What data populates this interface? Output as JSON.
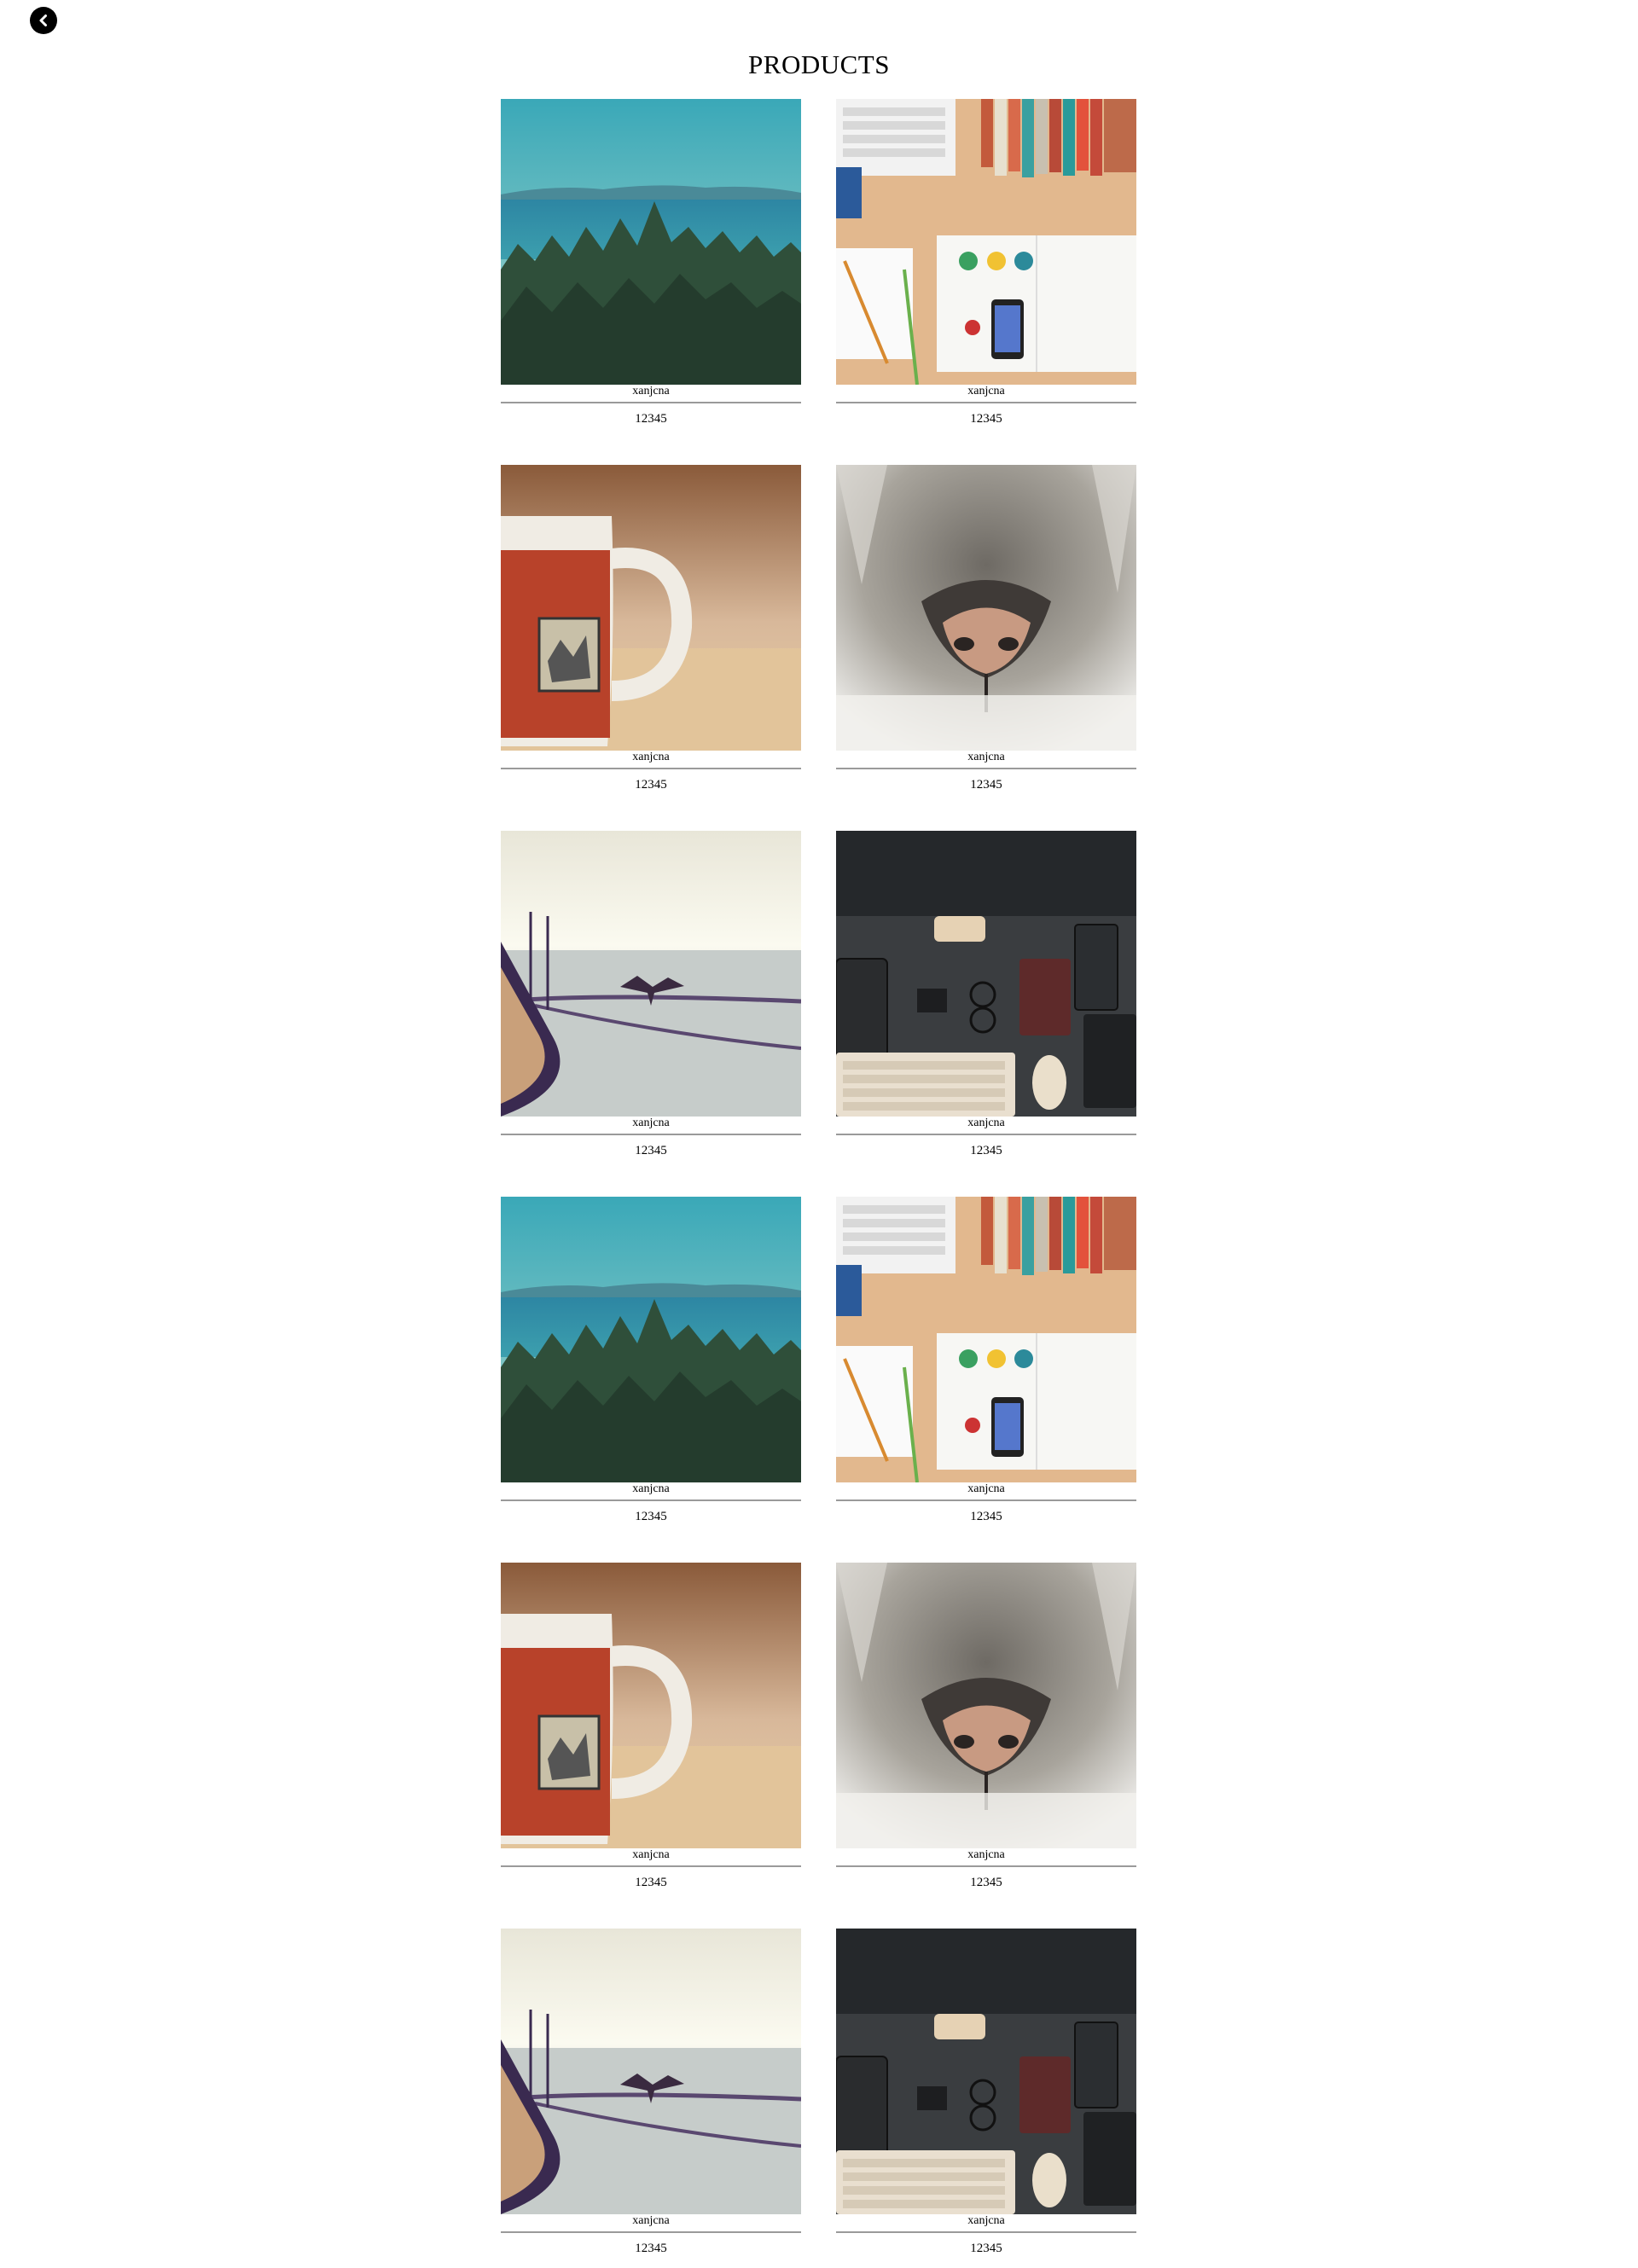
{
  "header": {
    "back_icon": "chevron-left-circle-icon",
    "title": "PRODUCTS"
  },
  "products": [
    {
      "name": "xanjcna",
      "price": "12345",
      "image": "forest-lake-photo"
    },
    {
      "name": "xanjcna",
      "price": "12345",
      "image": "desk-flatlay-photo"
    },
    {
      "name": "xanjcna",
      "price": "12345",
      "image": "coffee-mug-photo"
    },
    {
      "name": "xanjcna",
      "price": "12345",
      "image": "cat-nose-photo"
    },
    {
      "name": "xanjcna",
      "price": "12345",
      "image": "bird-boat-photo"
    },
    {
      "name": "xanjcna",
      "price": "12345",
      "image": "dark-desk-photo"
    },
    {
      "name": "xanjcna",
      "price": "12345",
      "image": "forest-lake-photo"
    },
    {
      "name": "xanjcna",
      "price": "12345",
      "image": "desk-flatlay-photo"
    },
    {
      "name": "xanjcna",
      "price": "12345",
      "image": "coffee-mug-photo"
    },
    {
      "name": "xanjcna",
      "price": "12345",
      "image": "cat-nose-photo"
    },
    {
      "name": "xanjcna",
      "price": "12345",
      "image": "bird-boat-photo"
    },
    {
      "name": "xanjcna",
      "price": "12345",
      "image": "dark-desk-photo"
    }
  ]
}
